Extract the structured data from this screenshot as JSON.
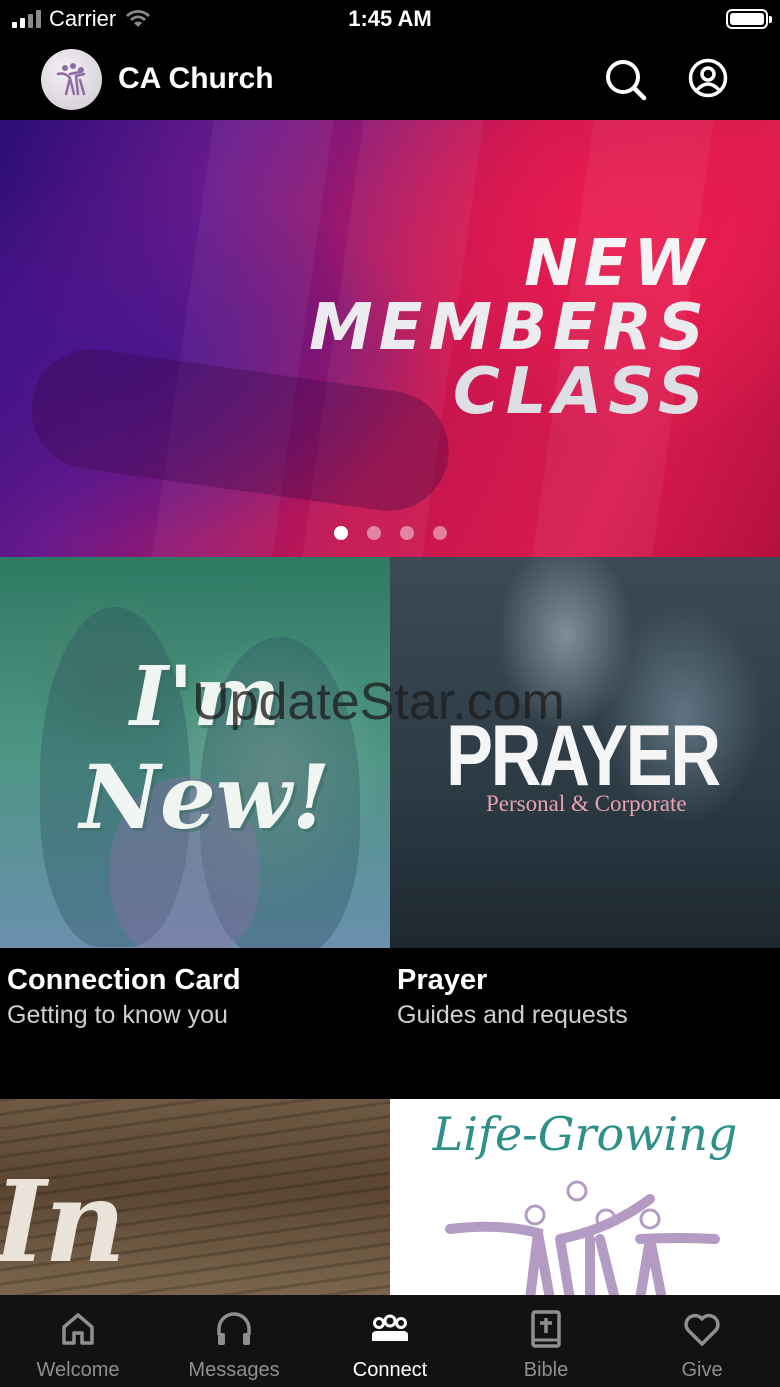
{
  "status_bar": {
    "carrier": "Carrier",
    "time": "1:45 AM"
  },
  "header": {
    "title": "CA Church"
  },
  "hero": {
    "lines": [
      "NEW",
      "MEMBERS",
      "CLASS"
    ],
    "page_count": 4,
    "active_page": 1
  },
  "cards": [
    {
      "image_lines": [
        "I'm",
        "New!"
      ],
      "title": "Connection Card",
      "subtitle": "Getting to know you"
    },
    {
      "image_title": "PRAYER",
      "image_subtitle": "Personal & Corporate",
      "title": "Prayer",
      "subtitle": "Guides and requests"
    },
    {
      "image_text": "In Our"
    },
    {
      "image_text": "Life-Growing"
    }
  ],
  "watermark": "UpdateStar.com",
  "tabs": [
    {
      "label": "Welcome",
      "icon": "home-icon",
      "active": false
    },
    {
      "label": "Messages",
      "icon": "headphones-icon",
      "active": false
    },
    {
      "label": "Connect",
      "icon": "group-icon",
      "active": true
    },
    {
      "label": "Bible",
      "icon": "bible-icon",
      "active": false
    },
    {
      "label": "Give",
      "icon": "heart-icon",
      "active": false
    }
  ],
  "colors": {
    "background": "#000000",
    "tab_bar": "#121212",
    "tab_inactive": "#8e8e93",
    "tab_active": "#ffffff",
    "hero_red": "#d81b4e",
    "hero_purple": "#2a0d78",
    "prayer_subtitle": "#e9a2ad",
    "life_growing_teal": "#2f8f8a"
  }
}
